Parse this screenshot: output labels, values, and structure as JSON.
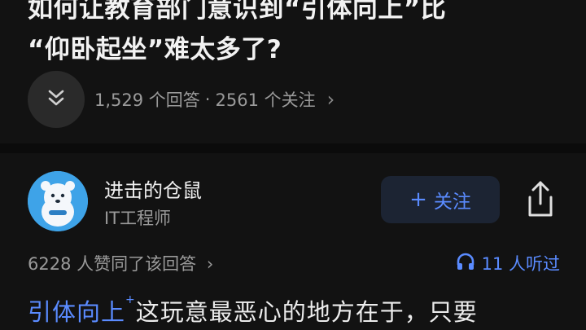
{
  "question": {
    "title_line1": "如何让教育部门意识到“引体向上”比",
    "title_line2": "“仰卧起坐”难太多了?",
    "answer_count": "1,529 个回答",
    "separator": "·",
    "follower_count": "2561 个关注",
    "more_chevron": "›"
  },
  "author": {
    "name": "进击的仓鼠",
    "title": "IT工程师",
    "follow_plus": "+",
    "follow_label": "关注"
  },
  "stats": {
    "likes": "6228 人赞同了该回答",
    "likes_chevron": "›",
    "listeners": "11 人听过"
  },
  "answer": {
    "keyword": "引体向上",
    "keyword_mark": "+",
    "text": "这玩意最恶心的地方在于，只要"
  },
  "colors": {
    "accent": "#5a8bff",
    "avatar": "#3ea3e8",
    "background": "#121212"
  },
  "icons": [
    "chevron-down-double-icon",
    "share-icon",
    "headphones-icon"
  ]
}
